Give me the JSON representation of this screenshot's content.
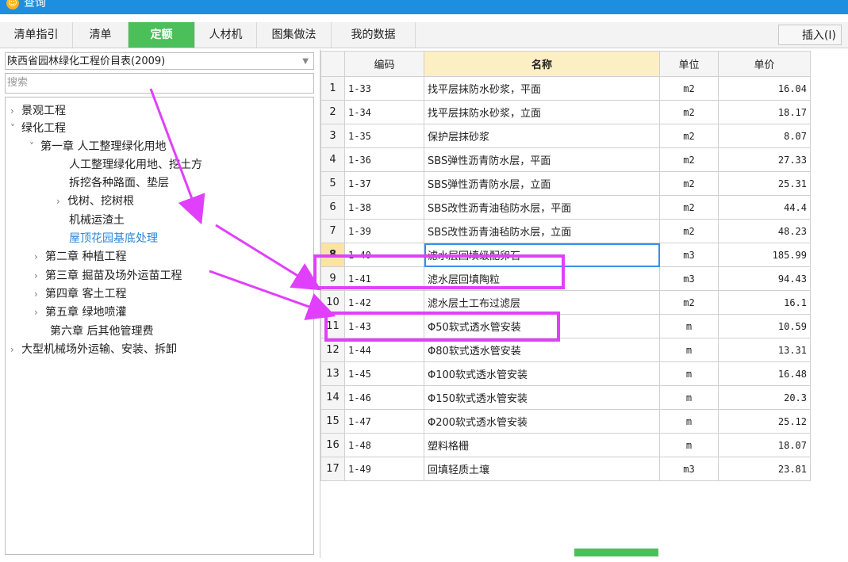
{
  "window": {
    "title": "查询"
  },
  "tabs": [
    {
      "label": "清单指引",
      "active": false
    },
    {
      "label": "清单",
      "active": false
    },
    {
      "label": "定额",
      "active": true
    },
    {
      "label": "人材机",
      "active": false
    },
    {
      "label": "图集做法",
      "active": false
    },
    {
      "label": "我的数据",
      "active": false
    }
  ],
  "toolbar": {
    "insert_label": "插入(I)"
  },
  "library": {
    "selected": "陕西省园林绿化工程价目表(2009)"
  },
  "search": {
    "placeholder": "搜索"
  },
  "tree": [
    {
      "label": "景观工程",
      "level": 0,
      "chevron": "right"
    },
    {
      "label": "绿化工程",
      "level": 0,
      "chevron": "down"
    },
    {
      "label": "第一章 人工整理绿化用地",
      "level": 1,
      "chevron": "down"
    },
    {
      "label": "人工整理绿化用地、挖土方",
      "level": 2,
      "chevron": ""
    },
    {
      "label": "拆挖各种路面、垫层",
      "level": 2,
      "chevron": ""
    },
    {
      "label": "伐树、挖树根",
      "level": 1,
      "chevron": "right"
    },
    {
      "label": "机械运渣土",
      "level": 2,
      "chevron": ""
    },
    {
      "label": "屋顶花园基底处理",
      "level": 2,
      "chevron": "",
      "selected": true
    },
    {
      "label": "第二章 种植工程",
      "level": 1,
      "chevron": "right"
    },
    {
      "label": "第三章 掘苗及场外运苗工程",
      "level": 1,
      "chevron": "right"
    },
    {
      "label": "第四章 客土工程",
      "level": 1,
      "chevron": "right"
    },
    {
      "label": "第五章 绿地喷灌",
      "level": 1,
      "chevron": "right"
    },
    {
      "label": "第六章 后其他管理费",
      "level": 1,
      "chevron": ""
    },
    {
      "label": "大型机械场外运输、安装、拆卸",
      "level": 0,
      "chevron": "right"
    }
  ],
  "table": {
    "headers": [
      "",
      "编码",
      "名称",
      "单位",
      "单价"
    ],
    "rows": [
      [
        "1",
        "1-33",
        "找平层抹防水砂浆，平面",
        "m2",
        "16.04"
      ],
      [
        "2",
        "1-34",
        "找平层抹防水砂浆，立面",
        "m2",
        "18.17"
      ],
      [
        "3",
        "1-35",
        "保护层抹砂浆",
        "m2",
        "8.07"
      ],
      [
        "4",
        "1-36",
        "SBS弹性沥青防水层，平面",
        "m2",
        "27.33"
      ],
      [
        "5",
        "1-37",
        "SBS弹性沥青防水层，立面",
        "m2",
        "25.31"
      ],
      [
        "6",
        "1-38",
        "SBS改性沥青油毡防水层，平面",
        "m2",
        "44.4"
      ],
      [
        "7",
        "1-39",
        "SBS改性沥青油毡防水层，立面",
        "m2",
        "48.23"
      ],
      [
        "8",
        "1-40",
        "滤水层回填级配卵石",
        "m3",
        "185.99"
      ],
      [
        "9",
        "1-41",
        "滤水层回填陶粒",
        "m3",
        "94.43"
      ],
      [
        "10",
        "1-42",
        "滤水层土工布过滤层",
        "m2",
        "16.1"
      ],
      [
        "11",
        "1-43",
        "Φ50软式透水管安装",
        "m",
        "10.59"
      ],
      [
        "12",
        "1-44",
        "Φ80软式透水管安装",
        "m",
        "13.31"
      ],
      [
        "13",
        "1-45",
        "Φ100软式透水管安装",
        "m",
        "16.48"
      ],
      [
        "14",
        "1-46",
        "Φ150软式透水管安装",
        "m",
        "20.3"
      ],
      [
        "15",
        "1-47",
        "Φ200软式透水管安装",
        "m",
        "25.12"
      ],
      [
        "16",
        "1-48",
        "塑料格栅",
        "m",
        "18.07"
      ],
      [
        "17",
        "1-49",
        "回填轻质土壤",
        "m3",
        "23.81"
      ]
    ],
    "active_row": 8
  },
  "colors": {
    "accent": "#4bbf5a",
    "highlight": "#e040fb",
    "titlebar": "#1e8ee0"
  }
}
